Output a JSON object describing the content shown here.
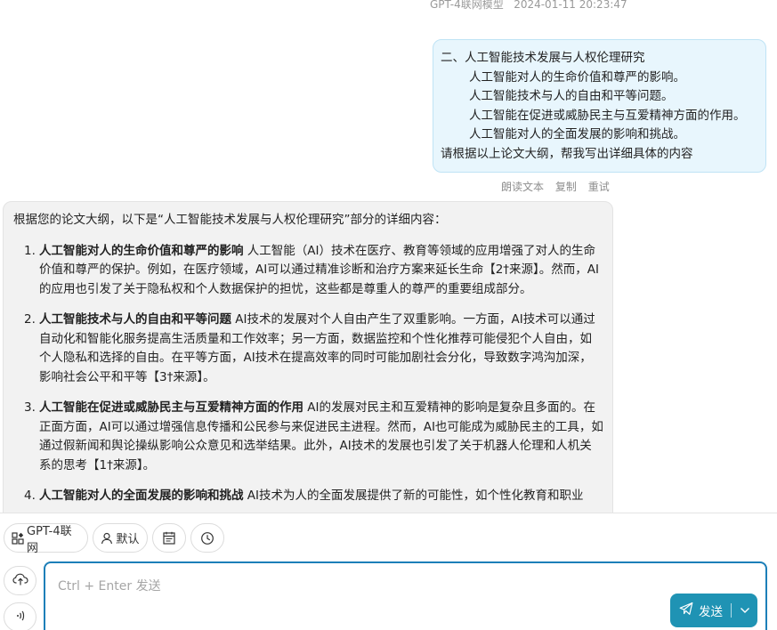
{
  "message_meta": {
    "model": "GPT-4联网模型",
    "timestamp": "2024-01-11 20:23:47"
  },
  "user_message": {
    "lines": [
      "二、人工智能技术发展与人权伦理研究",
      "人工智能对人的生命价值和尊严的影响。",
      "人工智能技术与人的自由和平等问题。",
      "人工智能在促进或威胁民主与互爱精神方面的作用。",
      "人工智能对人的全面发展的影响和挑战。",
      "请根据以上论文大纲，帮我写出详细具体的内容"
    ]
  },
  "message_actions": {
    "read_aloud": "朗读文本",
    "copy": "复制",
    "retry": "重试"
  },
  "ai_message": {
    "intro": "根据您的论文大纲，以下是“人工智能技术发展与人权伦理研究”部分的详细内容：",
    "items": [
      {
        "num": "1.",
        "title": "人工智能对人的生命价值和尊严的影响",
        "body": " 人工智能（AI）技术在医疗、教育等领域的应用增强了对人的生命价值和尊严的保护。例如，在医疗领域，AI可以通过精准诊断和治疗方案来延长生命【2†来源】。然而，AI的应用也引发了关于隐私权和个人数据保护的担忧，这些都是尊重人的尊严的重要组成部分。"
      },
      {
        "num": "2.",
        "title": "人工智能技术与人的自由和平等问题",
        "body": " AI技术的发展对个人自由产生了双重影响。一方面，AI技术可以通过自动化和智能化服务提高生活质量和工作效率；另一方面，数据监控和个性化推荐可能侵犯个人自由，如个人隐私和选择的自由。在平等方面，AI技术在提高效率的同时可能加剧社会分化，导致数字鸿沟加深，影响社会公平和平等【3†来源】。"
      },
      {
        "num": "3.",
        "title": "人工智能在促进或威胁民主与互爱精神方面的作用",
        "body": " AI的发展对民主和互爱精神的影响是复杂且多面的。在正面方面，AI可以通过增强信息传播和公民参与来促进民主进程。然而，AI也可能成为威胁民主的工具，如通过假新闻和舆论操纵影响公众意见和选举结果。此外，AI技术的发展也引发了关于机器人伦理和人机关系的思考【1†来源】。"
      },
      {
        "num": "4.",
        "title": "人工智能对人的全面发展的影响和挑战",
        "body": " AI技术为人的全面发展提供了新的可能性，如个性化教育和职业"
      }
    ]
  },
  "toolbar": {
    "model_chip": "GPT-4联网",
    "role_chip": "默认"
  },
  "composer": {
    "placeholder": "Ctrl + Enter 发送",
    "send_label": "发送"
  },
  "colors": {
    "accent": "#1f93b4",
    "input_border": "#1c7fb8",
    "user_bubble": "#e8f6fd",
    "ai_bubble": "#f2f2f2"
  }
}
